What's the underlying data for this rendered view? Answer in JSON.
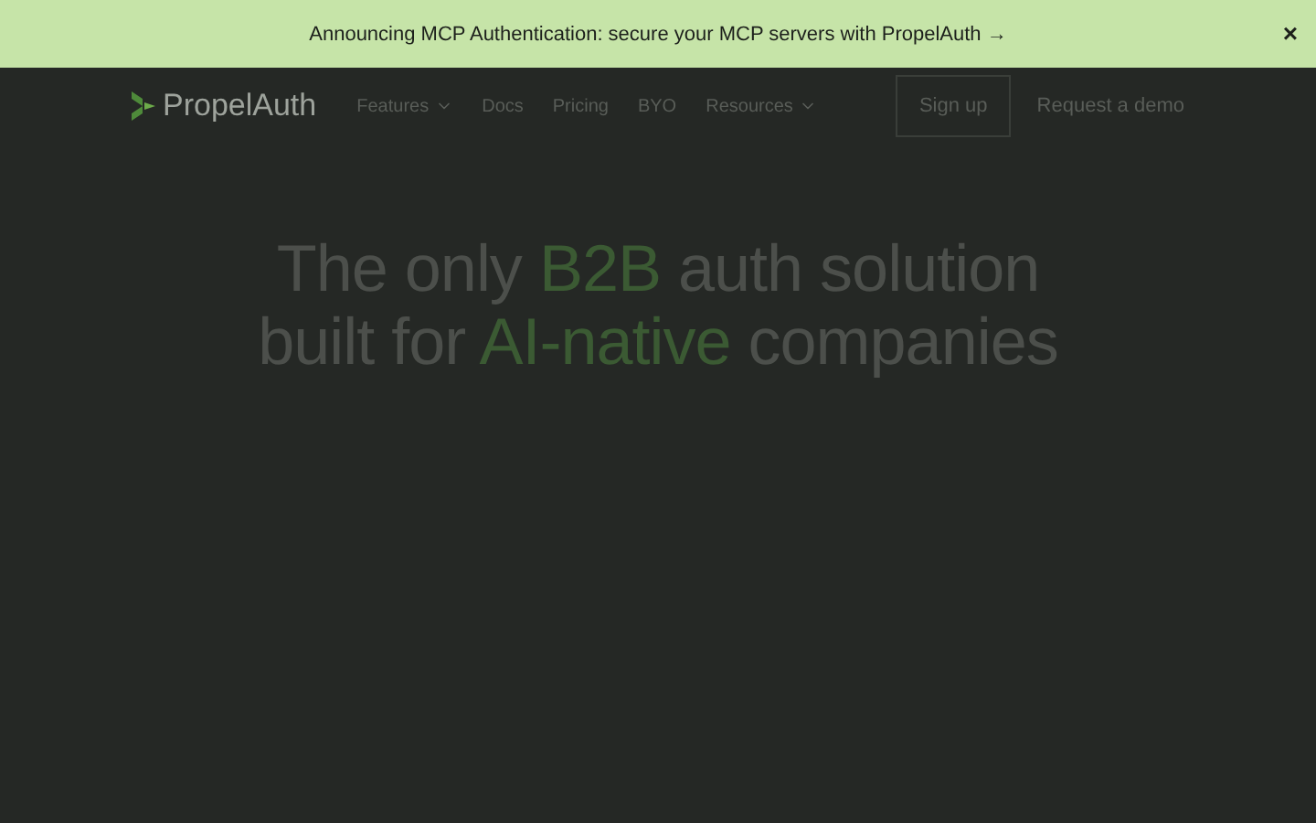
{
  "banner": {
    "text": "Announcing MCP Authentication: secure your MCP servers with PropelAuth",
    "arrow": "→",
    "close": "×"
  },
  "nav": {
    "brand": "PropelAuth",
    "links": [
      {
        "label": "Features",
        "dropdown": true
      },
      {
        "label": "Docs",
        "dropdown": false
      },
      {
        "label": "Pricing",
        "dropdown": false
      },
      {
        "label": "BYO",
        "dropdown": false
      },
      {
        "label": "Resources",
        "dropdown": true
      }
    ],
    "signup": "Sign up",
    "demo": "Request a demo"
  },
  "hero": {
    "lines": [
      [
        {
          "text": "The only ",
          "accent": false
        },
        {
          "text": "B2B",
          "accent": true
        },
        {
          "text": " auth solution",
          "accent": false
        }
      ],
      [
        {
          "text": "built for ",
          "accent": false
        },
        {
          "text": "AI-native",
          "accent": true
        },
        {
          "text": " companies",
          "accent": false
        }
      ]
    ]
  }
}
